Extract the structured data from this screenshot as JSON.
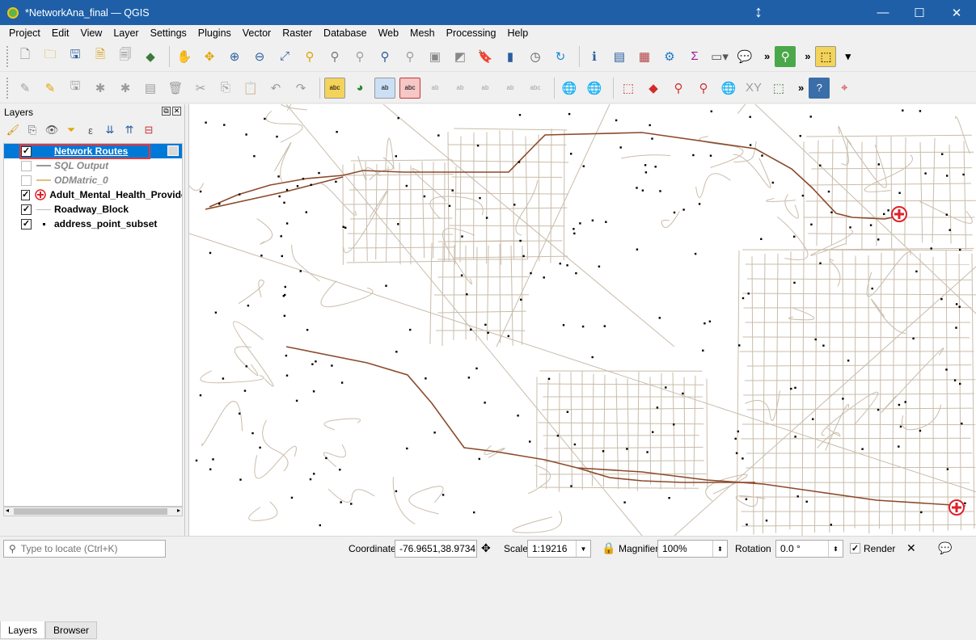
{
  "window": {
    "title": "*NetworkAna_final — QGIS",
    "minimize": "—",
    "maximize": "☐",
    "close": "✕"
  },
  "menu": [
    "Project",
    "Edit",
    "View",
    "Layer",
    "Settings",
    "Plugins",
    "Vector",
    "Raster",
    "Database",
    "Web",
    "Mesh",
    "Processing",
    "Help"
  ],
  "toolbar1_icons": [
    "new-project-icon",
    "open-project-icon",
    "save-project-icon",
    "new-print-layout-icon",
    "layout-manager-icon",
    "style-manager-icon",
    "pan-icon",
    "pan-to-selection-icon",
    "zoom-in-icon",
    "zoom-out-icon",
    "zoom-full-icon",
    "zoom-to-selection-icon",
    "zoom-to-layer-icon",
    "zoom-native-icon",
    "zoom-last-icon",
    "zoom-next-icon",
    "new-map-view-icon",
    "new-3d-view-icon",
    "new-bookmark-icon",
    "show-bookmarks-icon",
    "temporal-controller-icon",
    "refresh-icon",
    "identify-icon",
    "attribute-table-icon",
    "field-calculator-icon",
    "toolbox-icon",
    "statistics-icon",
    "measure-icon",
    "annotation-icon",
    "locator-search-icon",
    "select-features-icon"
  ],
  "toolbar2_icons": [
    "current-edits-icon",
    "toggle-editing-icon",
    "save-edits-icon",
    "digitize-icon",
    "vertex-tool-icon",
    "modify-attributes-icon",
    "delete-selected-icon",
    "cut-features-icon",
    "copy-features-icon",
    "paste-features-icon",
    "undo-icon",
    "redo-icon",
    "label-tool-icon",
    "diagram-tool-icon",
    "pin-labels-icon",
    "label-change-icon",
    "show-hide-labels-icon",
    "move-label-icon",
    "rotate-label-icon",
    "change-label-icon",
    "add-label-icon",
    "remove-label-icon",
    "add-wms-icon",
    "add-wfs-icon",
    "new-layer-icon",
    "georeferencer-icon",
    "zoom-layer-icon",
    "select-location-icon",
    "network-icon",
    "xy-tool-icon",
    "shape-tool-icon",
    "help-icon",
    "crosshair-icon"
  ],
  "layers": {
    "panel_title": "Layers",
    "items": [
      {
        "label": "Network Routes",
        "checked": true,
        "selected": true,
        "italic": false,
        "symbol": "line-blue"
      },
      {
        "label": "SQL Output",
        "checked": false,
        "selected": false,
        "italic": true,
        "symbol": "line-gray"
      },
      {
        "label": "ODMatric_0",
        "checked": false,
        "selected": false,
        "italic": true,
        "symbol": "line-tan"
      },
      {
        "label": "Adult_Mental_Health_Provide",
        "checked": true,
        "selected": false,
        "italic": false,
        "symbol": "health-cross"
      },
      {
        "label": "Roadway_Block",
        "checked": true,
        "selected": false,
        "italic": false,
        "symbol": "line-light"
      },
      {
        "label": "address_point_subset",
        "checked": true,
        "selected": false,
        "italic": false,
        "symbol": "point"
      }
    ],
    "tabs": [
      "Layers",
      "Browser"
    ]
  },
  "map": {
    "road_color": "#c9bcab",
    "route_color": "#8b4a2b",
    "point_color": "#000000",
    "health_color": "#e0202a"
  },
  "status": {
    "locator_placeholder": "Type to locate (Ctrl+K)",
    "coordinate_label": "Coordinate",
    "coordinate_value": "-76.9651,38.9734",
    "scale_label": "Scale",
    "scale_value": "1:19216",
    "magnifier_label": "Magnifier",
    "magnifier_value": "100%",
    "rotation_label": "Rotation",
    "rotation_value": "0.0 °",
    "render_label": "Render"
  }
}
